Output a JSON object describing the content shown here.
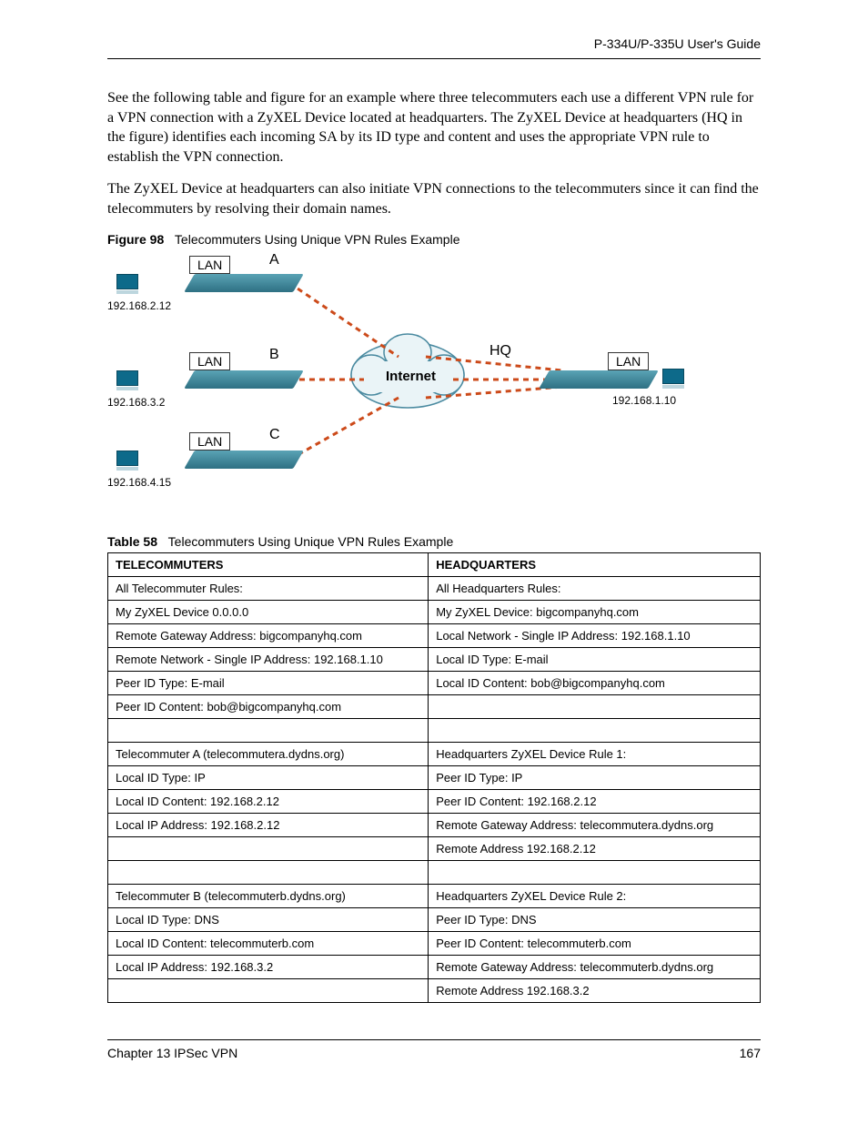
{
  "header": {
    "guide": "P-334U/P-335U User's Guide"
  },
  "paragraphs": {
    "p1": "See the following table and figure for an example where three telecommuters each use a different VPN rule for a VPN connection with a ZyXEL Device located at headquarters. The ZyXEL Device at headquarters (HQ in the figure) identifies each incoming SA by its ID type and content and uses the appropriate VPN rule to establish the VPN connection.",
    "p2": "The ZyXEL Device at headquarters can also initiate VPN connections to the telecommuters since it can find the telecommuters by resolving their domain names."
  },
  "figure": {
    "label": "Figure 98",
    "title": "Telecommuters Using Unique VPN Rules Example",
    "nodes": {
      "A": "A",
      "B": "B",
      "C": "C",
      "HQ": "HQ",
      "LAN": "LAN",
      "internet": "Internet",
      "ipA": "192.168.2.12",
      "ipB": "192.168.3.2",
      "ipC": "192.168.4.15",
      "ipHQ": "192.168.1.10"
    }
  },
  "table": {
    "label": "Table 58",
    "title": "Telecommuters Using Unique VPN Rules Example",
    "headers": [
      "TELECOMMUTERS",
      "HEADQUARTERS"
    ],
    "rows": [
      [
        "All Telecommuter Rules:",
        "All Headquarters Rules:"
      ],
      [
        "My ZyXEL Device  0.0.0.0",
        "My ZyXEL Device: bigcompanyhq.com"
      ],
      [
        "Remote Gateway Address: bigcompanyhq.com",
        "Local Network - Single IP Address: 192.168.1.10"
      ],
      [
        "Remote Network - Single IP Address: 192.168.1.10",
        "Local ID Type: E-mail"
      ],
      [
        "Peer ID Type: E-mail",
        "Local ID Content: bob@bigcompanyhq.com"
      ],
      [
        "Peer ID Content: bob@bigcompanyhq.com",
        ""
      ],
      [
        "",
        ""
      ],
      [
        "Telecommuter A (telecommutera.dydns.org)",
        "Headquarters ZyXEL Device Rule 1:"
      ],
      [
        "Local ID Type: IP",
        "Peer ID Type: IP"
      ],
      [
        "Local ID Content: 192.168.2.12",
        "Peer ID Content: 192.168.2.12"
      ],
      [
        "Local IP Address: 192.168.2.12",
        "Remote Gateway Address: telecommutera.dydns.org"
      ],
      [
        "",
        "Remote Address 192.168.2.12"
      ],
      [
        "",
        ""
      ],
      [
        "Telecommuter B (telecommuterb.dydns.org)",
        "Headquarters ZyXEL Device Rule 2:"
      ],
      [
        "Local ID Type: DNS",
        "Peer ID Type: DNS"
      ],
      [
        "Local ID Content: telecommuterb.com",
        "Peer ID Content: telecommuterb.com"
      ],
      [
        "Local IP Address: 192.168.3.2",
        "Remote Gateway Address: telecommuterb.dydns.org"
      ],
      [
        "",
        "Remote Address 192.168.3.2"
      ]
    ]
  },
  "footer": {
    "chapter": "Chapter 13 IPSec VPN",
    "page": "167"
  }
}
